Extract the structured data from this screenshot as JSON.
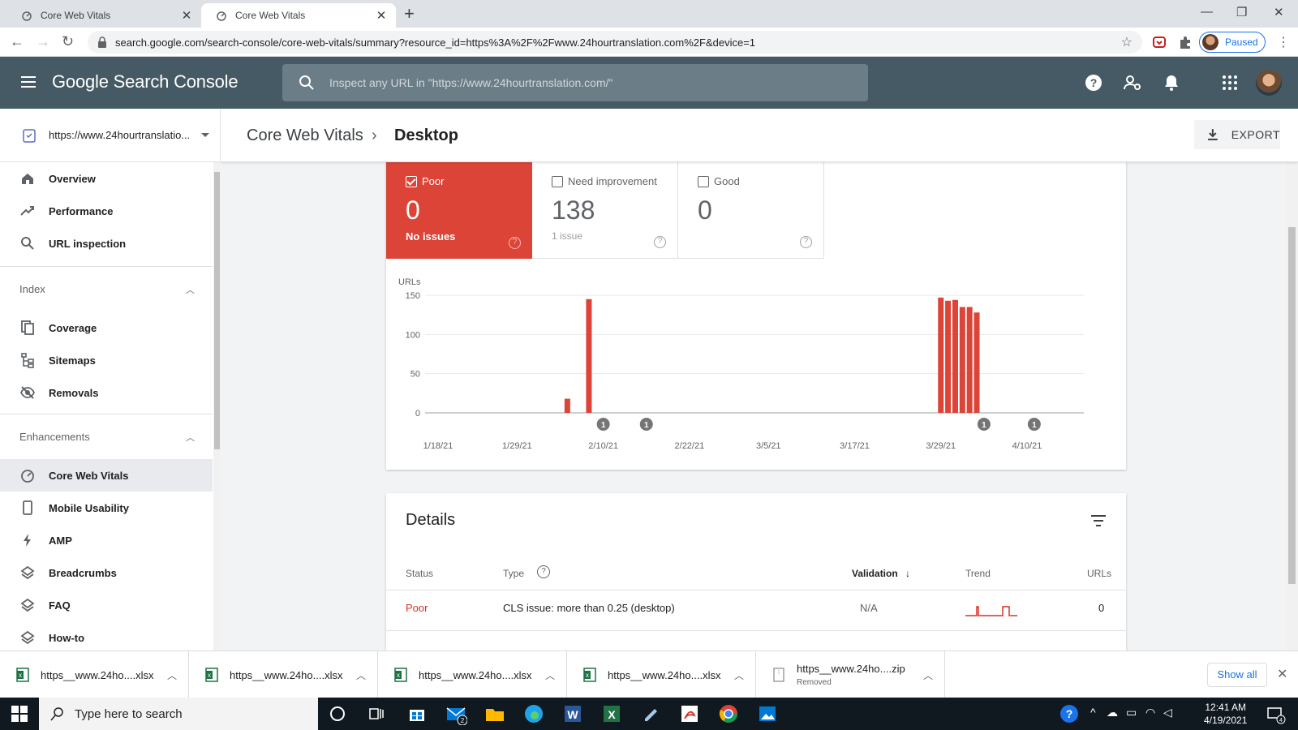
{
  "browser": {
    "tabs": [
      {
        "title": "Core Web Vitals",
        "active": false
      },
      {
        "title": "Core Web Vitals",
        "active": true
      }
    ],
    "url": "search.google.com/search-console/core-web-vitals/summary?resource_id=https%3A%2F%2Fwww.24hourtranslation.com%2F&device=1",
    "profile_status": "Paused"
  },
  "header": {
    "brand": "Google Search Console",
    "search_placeholder": "Inspect any URL in \"https://www.24hourtranslation.com/\""
  },
  "sidebar": {
    "property": "https://www.24hourtranslatio...",
    "items_top": [
      {
        "label": "Overview",
        "icon": "home-icon"
      },
      {
        "label": "Performance",
        "icon": "trending-up-icon"
      },
      {
        "label": "URL inspection",
        "icon": "search-icon"
      }
    ],
    "index_label": "Index",
    "index_items": [
      {
        "label": "Coverage",
        "icon": "file-copy-icon"
      },
      {
        "label": "Sitemaps",
        "icon": "sitemap-icon"
      },
      {
        "label": "Removals",
        "icon": "visibility-off-icon"
      }
    ],
    "enhancements_label": "Enhancements",
    "enhancement_items": [
      {
        "label": "Core Web Vitals",
        "icon": "speedometer-icon",
        "active": true
      },
      {
        "label": "Mobile Usability",
        "icon": "phone-icon"
      },
      {
        "label": "AMP",
        "icon": "bolt-icon"
      },
      {
        "label": "Breadcrumbs",
        "icon": "layers-icon"
      },
      {
        "label": "FAQ",
        "icon": "layers-icon"
      },
      {
        "label": "How-to",
        "icon": "layers-icon"
      }
    ]
  },
  "breadcrumb": {
    "parent": "Core Web Vitals",
    "current": "Desktop"
  },
  "export_label": "EXPORT",
  "tiles": [
    {
      "label": "Poor",
      "value": "0",
      "sub": "No issues",
      "checked": true
    },
    {
      "label": "Need improvement",
      "value": "138",
      "sub": "1 issue",
      "checked": false
    },
    {
      "label": "Good",
      "value": "0",
      "sub": "",
      "checked": false
    }
  ],
  "chart_data": {
    "type": "bar",
    "ylabel": "URLs",
    "ylim": [
      0,
      150
    ],
    "yticks": [
      0,
      50,
      100,
      150
    ],
    "xticks": [
      "1/18/21",
      "1/29/21",
      "2/10/21",
      "2/22/21",
      "3/5/21",
      "3/17/21",
      "3/29/21",
      "4/10/21"
    ],
    "x": [
      "2/5/21",
      "2/8/21",
      "3/29/21",
      "3/30/21",
      "3/31/21",
      "4/1/21",
      "4/2/21",
      "4/3/21"
    ],
    "values": [
      18,
      145,
      147,
      143,
      144,
      135,
      135,
      128
    ],
    "color": "#db4437",
    "annotations": [
      {
        "date": "2/10/21",
        "label": "1"
      },
      {
        "date": "2/16/21",
        "label": "1"
      },
      {
        "date": "4/4/21",
        "label": "1"
      },
      {
        "date": "4/11/21",
        "label": "1"
      }
    ],
    "grid": true
  },
  "details": {
    "title": "Details",
    "columns": [
      "Status",
      "Type",
      "Validation",
      "Trend",
      "URLs"
    ],
    "rows": [
      {
        "status": "Poor",
        "type": "CLS issue: more than 0.25 (desktop)",
        "validation": "N/A",
        "urls": "0"
      }
    ]
  },
  "downloads": [
    {
      "name": "https__www.24ho....xlsx",
      "icon": "excel-file-icon"
    },
    {
      "name": "https__www.24ho....xlsx",
      "icon": "excel-file-icon"
    },
    {
      "name": "https__www.24ho....xlsx",
      "icon": "excel-file-icon"
    },
    {
      "name": "https__www.24ho....xlsx",
      "icon": "excel-file-icon"
    },
    {
      "name": "https__www.24ho....zip",
      "icon": "zip-file-icon",
      "status": "Removed"
    }
  ],
  "show_all": "Show all",
  "taskbar": {
    "search_placeholder": "Type here to search",
    "time": "12:41 AM",
    "date": "4/19/2021",
    "mail_badge": "2",
    "notif_badge": "4"
  }
}
